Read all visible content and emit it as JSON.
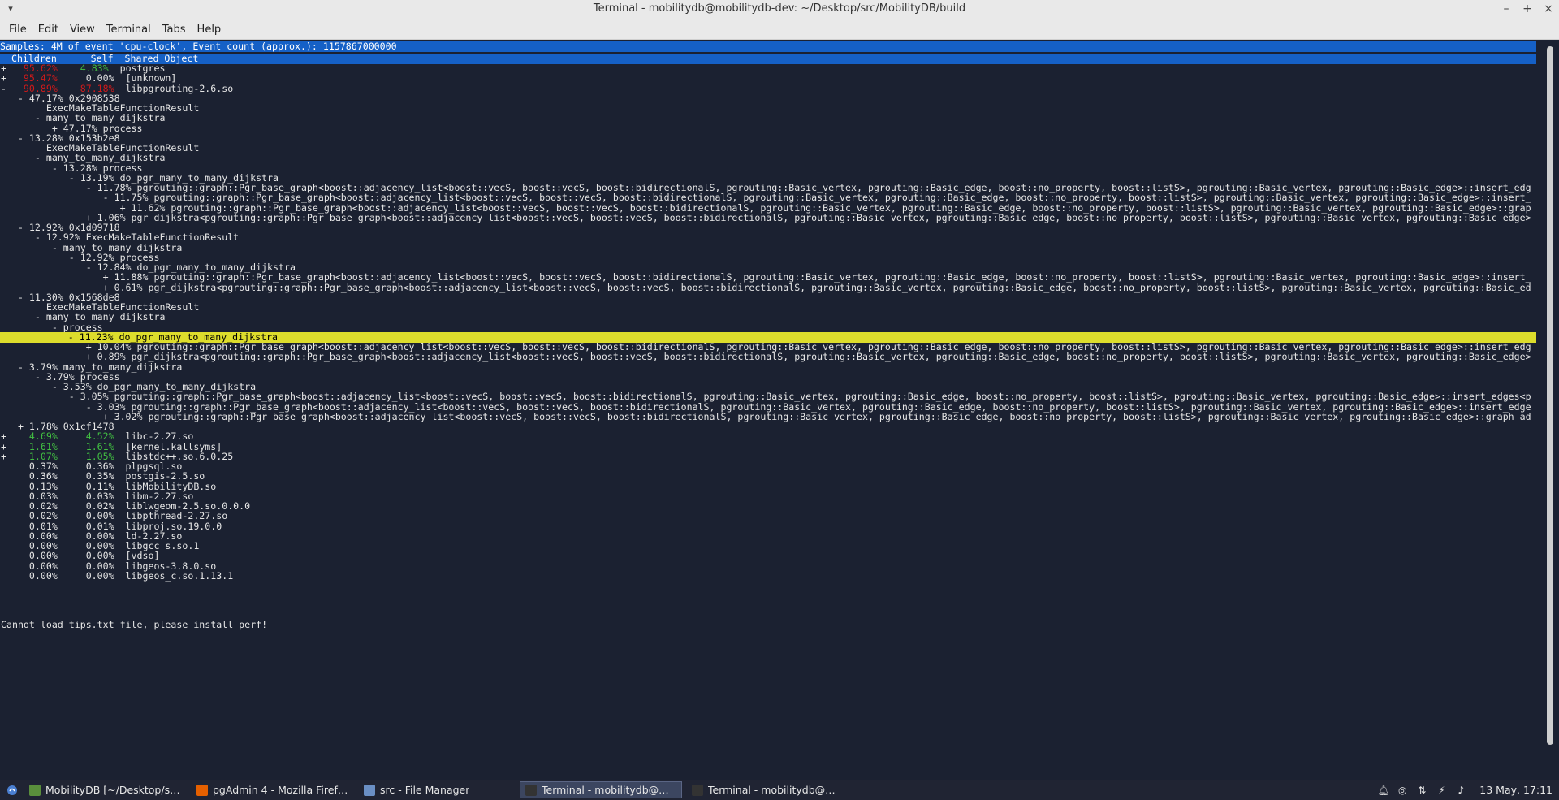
{
  "window": {
    "title": "Terminal - mobilitydb@mobilitydb-dev: ~/Desktop/src/MobilityDB/build",
    "controls": {
      "minimize": "–",
      "maximize": "+",
      "close": "×"
    }
  },
  "menubar": {
    "items": [
      "File",
      "Edit",
      "View",
      "Terminal",
      "Tabs",
      "Help"
    ]
  },
  "perf": {
    "summary": "Samples: 4M of event 'cpu-clock', Event count (approx.): 1157867000000",
    "column_header": "  Children      Self  Shared Object",
    "lines": [
      {
        "segs": [
          {
            "t": "+   "
          },
          {
            "t": "95.62%",
            "c": "red"
          },
          {
            "t": "    "
          },
          {
            "t": "4.83%",
            "c": "green"
          },
          {
            "t": "  postgres"
          }
        ]
      },
      {
        "segs": [
          {
            "t": "+   "
          },
          {
            "t": "95.47%",
            "c": "red"
          },
          {
            "t": "     0.00%  [unknown]"
          }
        ]
      },
      {
        "segs": [
          {
            "t": "-   "
          },
          {
            "t": "90.89%",
            "c": "red"
          },
          {
            "t": "    "
          },
          {
            "t": "87.18%",
            "c": "red"
          },
          {
            "t": "  libpgrouting-2.6.so"
          }
        ]
      },
      {
        "segs": [
          {
            "t": "   - 47.17% 0x2908538"
          }
        ]
      },
      {
        "segs": [
          {
            "t": "        ExecMakeTableFunctionResult"
          }
        ]
      },
      {
        "segs": [
          {
            "t": "      - many_to_many_dijkstra"
          }
        ]
      },
      {
        "segs": [
          {
            "t": "         + 47.17% process"
          }
        ]
      },
      {
        "segs": [
          {
            "t": "   - 13.28% 0x153b2e8"
          }
        ]
      },
      {
        "segs": [
          {
            "t": "        ExecMakeTableFunctionResult"
          }
        ]
      },
      {
        "segs": [
          {
            "t": "      - many_to_many_dijkstra"
          }
        ]
      },
      {
        "segs": [
          {
            "t": "         - 13.28% process"
          }
        ]
      },
      {
        "segs": [
          {
            "t": "            - 13.19% do_pgr_many_to_many_dijkstra"
          }
        ]
      },
      {
        "segs": [
          {
            "t": "               - 11.78% pgrouting::graph::Pgr_base_graph<boost::adjacency_list<boost::vecS, boost::vecS, boost::bidirectionalS, pgrouting::Basic_vertex, pgrouting::Basic_edge, boost::no_property, boost::listS>, pgrouting::Basic_vertex, pgrouting::Basic_edge>::insert_edg"
          }
        ]
      },
      {
        "segs": [
          {
            "t": "                  - 11.75% pgrouting::graph::Pgr_base_graph<boost::adjacency_list<boost::vecS, boost::vecS, boost::bidirectionalS, pgrouting::Basic_vertex, pgrouting::Basic_edge, boost::no_property, boost::listS>, pgrouting::Basic_vertex, pgrouting::Basic_edge>::insert_"
          }
        ]
      },
      {
        "segs": [
          {
            "t": "                     + 11.62% pgrouting::graph::Pgr_base_graph<boost::adjacency_list<boost::vecS, boost::vecS, boost::bidirectionalS, pgrouting::Basic_vertex, pgrouting::Basic_edge, boost::no_property, boost::listS>, pgrouting::Basic_vertex, pgrouting::Basic_edge>::grap"
          }
        ]
      },
      {
        "segs": [
          {
            "t": "               + 1.06% pgr_dijkstra<pgrouting::graph::Pgr_base_graph<boost::adjacency_list<boost::vecS, boost::vecS, boost::bidirectionalS, pgrouting::Basic_vertex, pgrouting::Basic_edge, boost::no_property, boost::listS>, pgrouting::Basic_vertex, pgrouting::Basic_edge>"
          }
        ]
      },
      {
        "segs": [
          {
            "t": "   - 12.92% 0x1d09718"
          }
        ]
      },
      {
        "segs": [
          {
            "t": "      - 12.92% ExecMakeTableFunctionResult"
          }
        ]
      },
      {
        "segs": [
          {
            "t": "         - many_to_many_dijkstra"
          }
        ]
      },
      {
        "segs": [
          {
            "t": "            - 12.92% process"
          }
        ]
      },
      {
        "segs": [
          {
            "t": "               - 12.84% do_pgr_many_to_many_dijkstra"
          }
        ]
      },
      {
        "segs": [
          {
            "t": "                  + 11.88% pgrouting::graph::Pgr_base_graph<boost::adjacency_list<boost::vecS, boost::vecS, boost::bidirectionalS, pgrouting::Basic_vertex, pgrouting::Basic_edge, boost::no_property, boost::listS>, pgrouting::Basic_vertex, pgrouting::Basic_edge>::insert_"
          }
        ]
      },
      {
        "segs": [
          {
            "t": "                  + 0.61% pgr_dijkstra<pgrouting::graph::Pgr_base_graph<boost::adjacency_list<boost::vecS, boost::vecS, boost::bidirectionalS, pgrouting::Basic_vertex, pgrouting::Basic_edge, boost::no_property, boost::listS>, pgrouting::Basic_vertex, pgrouting::Basic_ed"
          }
        ]
      },
      {
        "segs": [
          {
            "t": "   - 11.30% 0x1568de8"
          }
        ]
      },
      {
        "segs": [
          {
            "t": "        ExecMakeTableFunctionResult"
          }
        ]
      },
      {
        "segs": [
          {
            "t": "      - many_to_many_dijkstra"
          }
        ]
      },
      {
        "segs": [
          {
            "t": "         - process"
          }
        ]
      },
      {
        "segs": [
          {
            "t": "            - 11.23% do_pgr_many_to_many_dijkstra"
          }
        ],
        "cursor": true
      },
      {
        "segs": [
          {
            "t": "               + 10.04% pgrouting::graph::Pgr_base_graph<boost::adjacency_list<boost::vecS, boost::vecS, boost::bidirectionalS, pgrouting::Basic_vertex, pgrouting::Basic_edge, boost::no_property, boost::listS>, pgrouting::Basic_vertex, pgrouting::Basic_edge>::insert_edg"
          }
        ]
      },
      {
        "segs": [
          {
            "t": "               + 0.89% pgr_dijkstra<pgrouting::graph::Pgr_base_graph<boost::adjacency_list<boost::vecS, boost::vecS, boost::bidirectionalS, pgrouting::Basic_vertex, pgrouting::Basic_edge, boost::no_property, boost::listS>, pgrouting::Basic_vertex, pgrouting::Basic_edge>"
          }
        ]
      },
      {
        "segs": [
          {
            "t": "   - 3.79% many_to_many_dijkstra"
          }
        ]
      },
      {
        "segs": [
          {
            "t": "      - 3.79% process"
          }
        ]
      },
      {
        "segs": [
          {
            "t": "         - 3.53% do_pgr_many_to_many_dijkstra"
          }
        ]
      },
      {
        "segs": [
          {
            "t": "            - 3.05% pgrouting::graph::Pgr_base_graph<boost::adjacency_list<boost::vecS, boost::vecS, boost::bidirectionalS, pgrouting::Basic_vertex, pgrouting::Basic_edge, boost::no_property, boost::listS>, pgrouting::Basic_vertex, pgrouting::Basic_edge>::insert_edges<p"
          }
        ]
      },
      {
        "segs": [
          {
            "t": "               - 3.03% pgrouting::graph::Pgr_base_graph<boost::adjacency_list<boost::vecS, boost::vecS, boost::bidirectionalS, pgrouting::Basic_vertex, pgrouting::Basic_edge, boost::no_property, boost::listS>, pgrouting::Basic_vertex, pgrouting::Basic_edge>::insert_edge"
          }
        ]
      },
      {
        "segs": [
          {
            "t": "                  + 3.02% pgrouting::graph::Pgr_base_graph<boost::adjacency_list<boost::vecS, boost::vecS, boost::bidirectionalS, pgrouting::Basic_vertex, pgrouting::Basic_edge, boost::no_property, boost::listS>, pgrouting::Basic_vertex, pgrouting::Basic_edge>::graph_ad"
          }
        ]
      },
      {
        "segs": [
          {
            "t": "   + 1.78% 0x1cf1478"
          }
        ]
      },
      {
        "segs": [
          {
            "t": "+    "
          },
          {
            "t": "4.69%",
            "c": "green"
          },
          {
            "t": "     "
          },
          {
            "t": "4.52%",
            "c": "green"
          },
          {
            "t": "  libc-2.27.so"
          }
        ]
      },
      {
        "segs": [
          {
            "t": "+    "
          },
          {
            "t": "1.61%",
            "c": "green"
          },
          {
            "t": "     "
          },
          {
            "t": "1.61%",
            "c": "green"
          },
          {
            "t": "  [kernel.kallsyms]"
          }
        ]
      },
      {
        "segs": [
          {
            "t": "+    "
          },
          {
            "t": "1.07%",
            "c": "green"
          },
          {
            "t": "     "
          },
          {
            "t": "1.05%",
            "c": "green"
          },
          {
            "t": "  libstdc++.so.6.0.25"
          }
        ]
      },
      {
        "segs": [
          {
            "t": "     0.37%     0.36%  plpgsql.so"
          }
        ]
      },
      {
        "segs": [
          {
            "t": "     0.36%     0.35%  postgis-2.5.so"
          }
        ]
      },
      {
        "segs": [
          {
            "t": "     0.13%     0.11%  libMobilityDB.so"
          }
        ]
      },
      {
        "segs": [
          {
            "t": "     0.03%     0.03%  libm-2.27.so"
          }
        ]
      },
      {
        "segs": [
          {
            "t": "     0.02%     0.02%  liblwgeom-2.5.so.0.0.0"
          }
        ]
      },
      {
        "segs": [
          {
            "t": "     0.02%     0.00%  libpthread-2.27.so"
          }
        ]
      },
      {
        "segs": [
          {
            "t": "     0.01%     0.01%  libproj.so.19.0.0"
          }
        ]
      },
      {
        "segs": [
          {
            "t": "     0.00%     0.00%  ld-2.27.so"
          }
        ]
      },
      {
        "segs": [
          {
            "t": "     0.00%     0.00%  libgcc_s.so.1"
          }
        ]
      },
      {
        "segs": [
          {
            "t": "     0.00%     0.00%  [vdso]"
          }
        ]
      },
      {
        "segs": [
          {
            "t": "     0.00%     0.00%  libgeos-3.8.0.so"
          }
        ]
      },
      {
        "segs": [
          {
            "t": "     0.00%     0.00%  libgeos_c.so.1.13.1"
          }
        ]
      }
    ],
    "footer": "Cannot load tips.txt file, please install perf!"
  },
  "taskbar": {
    "tasks": [
      {
        "label": "MobilityDB [~/Desktop/src/M...",
        "icon": "text-editor-icon",
        "color": "#5a8f3c",
        "active": false
      },
      {
        "label": "pgAdmin 4 - Mozilla Firefox",
        "icon": "firefox-icon",
        "color": "#e66000",
        "active": false
      },
      {
        "label": "src - File Manager",
        "icon": "folder-icon",
        "color": "#6a8fc4",
        "active": false
      },
      {
        "label": "Terminal - mobilitydb@mobil...",
        "icon": "terminal-icon",
        "color": "#333333",
        "active": true
      },
      {
        "label": "Terminal - mobilitydb@mobil...",
        "icon": "terminal-icon",
        "color": "#333333",
        "active": false
      }
    ],
    "clock": "13 May, 17:11"
  },
  "colors": {
    "terminal_bg": "#1b2131",
    "header_bg": "#1560c6",
    "cursor_bg": "#dddd2c",
    "red": "#d01a1a",
    "green": "#42c042"
  }
}
